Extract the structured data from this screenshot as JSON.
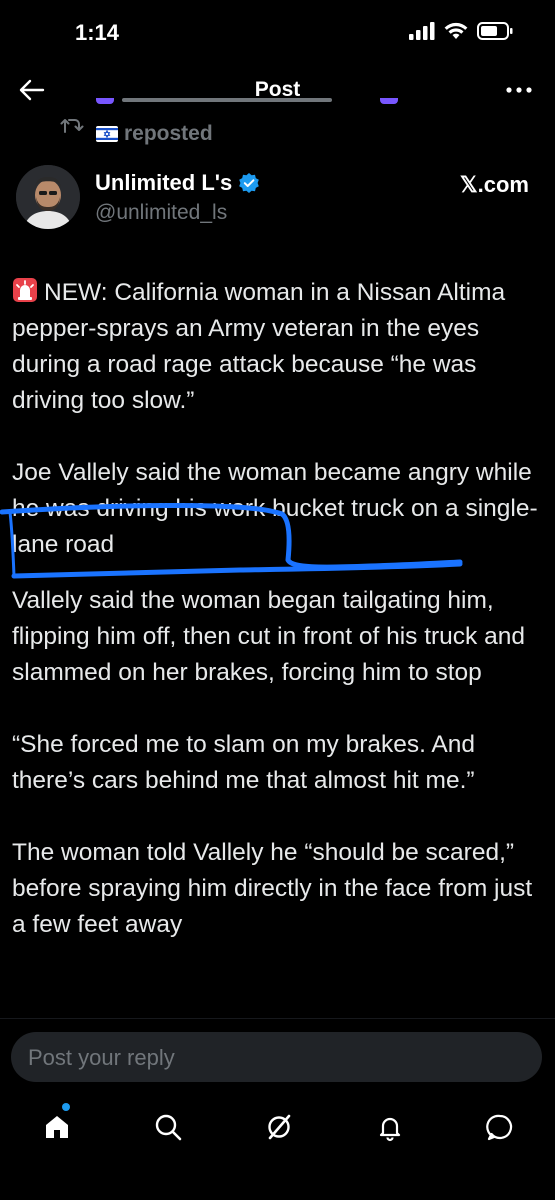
{
  "status_bar": {
    "time": "1:14"
  },
  "nav": {
    "title": "Post",
    "back_icon": "arrow-left-icon",
    "more_icon": "more-horizontal-icon"
  },
  "repost": {
    "label": "reposted",
    "flag_icon": "israel-flag-icon"
  },
  "author": {
    "name": "Unlimited L's",
    "handle": "@unlimited_ls",
    "verified_color": "#1d9bf0",
    "source": "𝕏.com"
  },
  "post": {
    "paragraphs": [
      "NEW: California woman in a Nissan Altima pepper-sprays an Army veteran in the eyes during a road rage attack because “he was driving too slow.”",
      "Joe Vallely said the woman became angry while he was driving his work bucket truck on a single-lane road",
      "Vallely said the woman began tailgating him, flipping him off, then cut in front of his truck and slammed on her brakes, forcing him to stop",
      "“She forced me to slam on my brakes. And there’s cars behind me that almost hit me.”",
      "The woman told Vallely he “should be scared,” before spraying him directly in the face from just a few feet away"
    ],
    "alert_icon": "siren-icon",
    "highlight_color": "#1a73ff"
  },
  "reply": {
    "placeholder": "Post your reply"
  },
  "tabs": [
    {
      "name": "home",
      "icon": "home-icon"
    },
    {
      "name": "search",
      "icon": "search-icon"
    },
    {
      "name": "grok",
      "icon": "grok-icon"
    },
    {
      "name": "notifications",
      "icon": "bell-icon"
    },
    {
      "name": "messages",
      "icon": "message-icon"
    }
  ],
  "colors": {
    "background": "#000000",
    "text": "#e7e9ea",
    "secondary": "#71767b",
    "accent": "#1d9bf0"
  }
}
